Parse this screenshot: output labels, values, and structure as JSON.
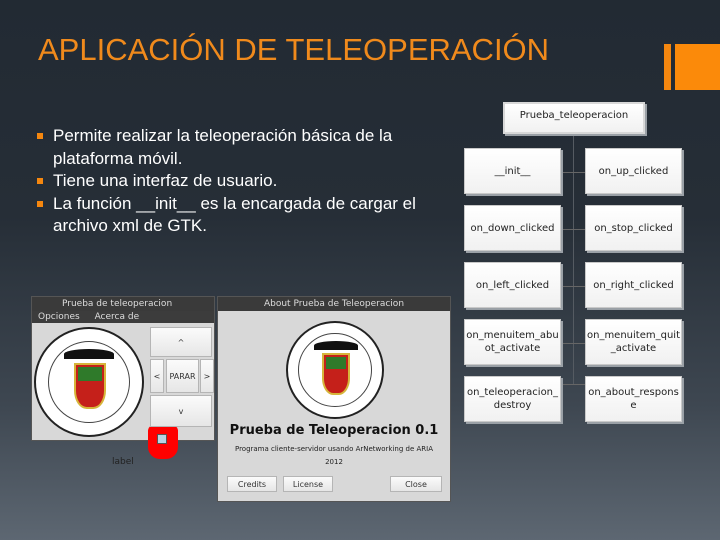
{
  "slide": {
    "title": "APLICACIÓN DE TELEOPERACIÓN",
    "accent_color": "#f5870f",
    "bullets": [
      {
        "text": "Permite realizar la teleoperación básica de la plataforma móvil."
      },
      {
        "text": "Tiene una interfaz de usuario."
      },
      {
        "text": "La función __init__ es la encargada de cargar el archivo xml de GTK."
      }
    ]
  },
  "diagram": {
    "root": "Prueba_teleoperacion",
    "left_nodes": [
      "__init__",
      "on_down_clicked",
      "on_left_clicked",
      "on_menuitem_abuot_activate",
      "on_teleoperacion_destroy"
    ],
    "right_nodes": [
      "on_up_clicked",
      "on_stop_clicked",
      "on_right_clicked",
      "on_menuitem_quit_activate",
      "on_about_response"
    ]
  },
  "main_window": {
    "title": "Prueba de teleoperacion",
    "menu": [
      "Opciones",
      "Acerca de"
    ],
    "buttons": {
      "up": "^",
      "left": "<",
      "stop": "PARAR",
      "right": ">",
      "down": "v"
    },
    "label": "label"
  },
  "about_dialog": {
    "title": "About Prueba de Teleoperacion",
    "app_name": "Prueba de Teleoperacion 0.1",
    "description": "Programa cliente-servidor usando ArNetworking de ARIA",
    "year": "2012",
    "buttons": {
      "credits": "Credits",
      "license": "License",
      "close": "Close"
    }
  }
}
